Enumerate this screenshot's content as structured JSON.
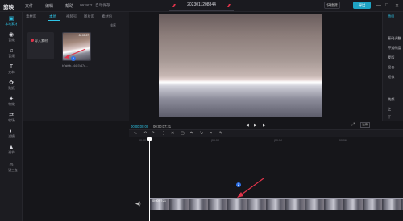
{
  "app": {
    "logo_text": "剪映",
    "menus": [
      "文件",
      "编辑",
      "帮助"
    ],
    "autosave": "09:46:21 自动保存",
    "project_name": "2023011208844",
    "shortcut_label": "快捷键",
    "export_label": "导出",
    "window_controls": [
      "—",
      "□",
      "✕"
    ]
  },
  "rail": {
    "items": [
      {
        "icon": "▣",
        "label": "本地素材",
        "active": true
      },
      {
        "icon": "◉",
        "label": "音效"
      },
      {
        "icon": "♫",
        "label": "音频"
      },
      {
        "icon": "T",
        "label": "文本"
      },
      {
        "icon": "✿",
        "label": "贴纸"
      },
      {
        "icon": "✦",
        "label": "特效"
      },
      {
        "icon": "⇄",
        "label": "转场"
      },
      {
        "icon": "◐",
        "label": "滤镜"
      },
      {
        "icon": "▲",
        "label": "调节"
      },
      {
        "icon": "☺",
        "label": "一键三连"
      }
    ]
  },
  "media": {
    "tabs": [
      {
        "label": "素材库"
      },
      {
        "label": "本地",
        "active": true
      },
      {
        "label": "视频号"
      },
      {
        "label": "图片库"
      },
      {
        "label": "素材包"
      }
    ],
    "sort_label": "排序",
    "import_label": "导入素材",
    "thumb_duration": "00:00:07",
    "thumb_name": "b7ab9b...44c7c47d...",
    "badge1": "1"
  },
  "player": {
    "time_current": "00:00:00:00",
    "time_total": "00:00:07:21",
    "ratio_label": "比例"
  },
  "props": {
    "items": [
      {
        "label": "画面",
        "active": true
      },
      {
        "label": "基础调整"
      },
      {
        "label": "不透明度"
      },
      {
        "label": "蒙版"
      },
      {
        "label": "混合"
      },
      {
        "label": "抠像"
      },
      {
        "label": "美颜"
      },
      {
        "label": "上"
      },
      {
        "label": "下"
      }
    ]
  },
  "timeline": {
    "ruler": [
      "00:00",
      "|00:02",
      "|00:04",
      "|00:06"
    ],
    "clip_label": "00:00:07:21",
    "badge2": "2"
  },
  "colors": {
    "accent": "#2ec4e6",
    "badge": "#2c6fe6",
    "arrow": "#e0334a",
    "background": "#16161a",
    "panel": "#1c1c21"
  }
}
